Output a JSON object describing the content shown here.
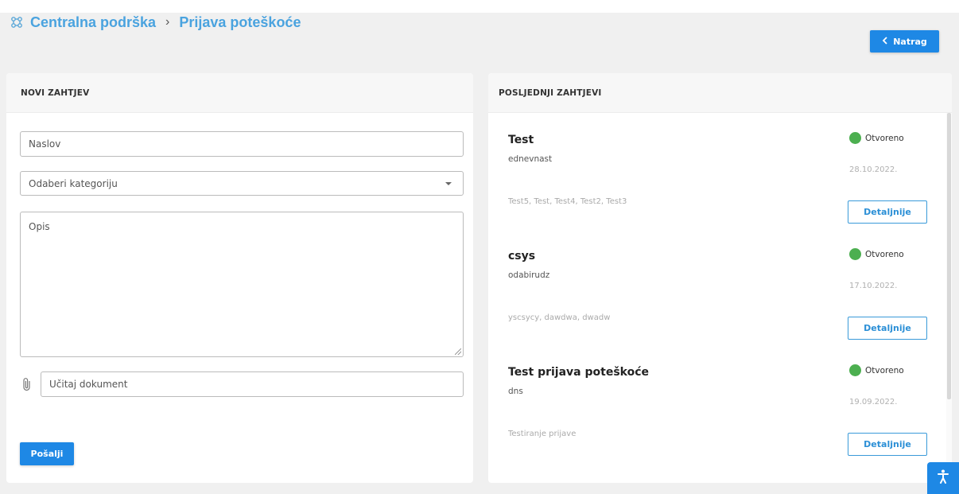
{
  "breadcrumb": {
    "root": "Centralna podrška",
    "separator": "›",
    "current": "Prijava poteškoće"
  },
  "back_button": {
    "label": "Natrag",
    "icon": "chevron-left-icon"
  },
  "new_request": {
    "header": "NOVI ZAHTJEV",
    "title_field": {
      "value": "",
      "placeholder": "Naslov"
    },
    "category_select": {
      "selected": "Odaberi kategoriju"
    },
    "description_field": {
      "value": "",
      "placeholder": "Opis"
    },
    "upload_field": {
      "value": "",
      "placeholder": "Učitaj dokument",
      "icon": "paperclip-icon"
    },
    "submit_label": "Pošalji"
  },
  "recent_requests": {
    "header": "POSLJEDNJI ZAHTJEVI",
    "items": [
      {
        "title": "Test",
        "subtitle": "ednevnast",
        "tags": "Test5, Test, Test4, Test2, Test3",
        "status": "Otvoreno",
        "date": "28.10.2022.",
        "button": "Detaljnije"
      },
      {
        "title": "csys",
        "subtitle": "odabirudz",
        "tags": "yscsycy, dawdwa, dwadw",
        "status": "Otvoreno",
        "date": "17.10.2022.",
        "button": "Detaljnije"
      },
      {
        "title": "Test prijava poteškoće",
        "subtitle": "dns",
        "tags": "Testiranje prijave",
        "status": "Otvoreno",
        "date": "19.09.2022.",
        "button": "Detaljnije"
      }
    ]
  },
  "colors": {
    "primary": "#1e88e5",
    "breadcrumb": "#4aa3df",
    "status_open": "#4caf50",
    "page_bg": "#f0f0f0"
  },
  "accessibility_button": {
    "icon": "accessibility-icon"
  }
}
